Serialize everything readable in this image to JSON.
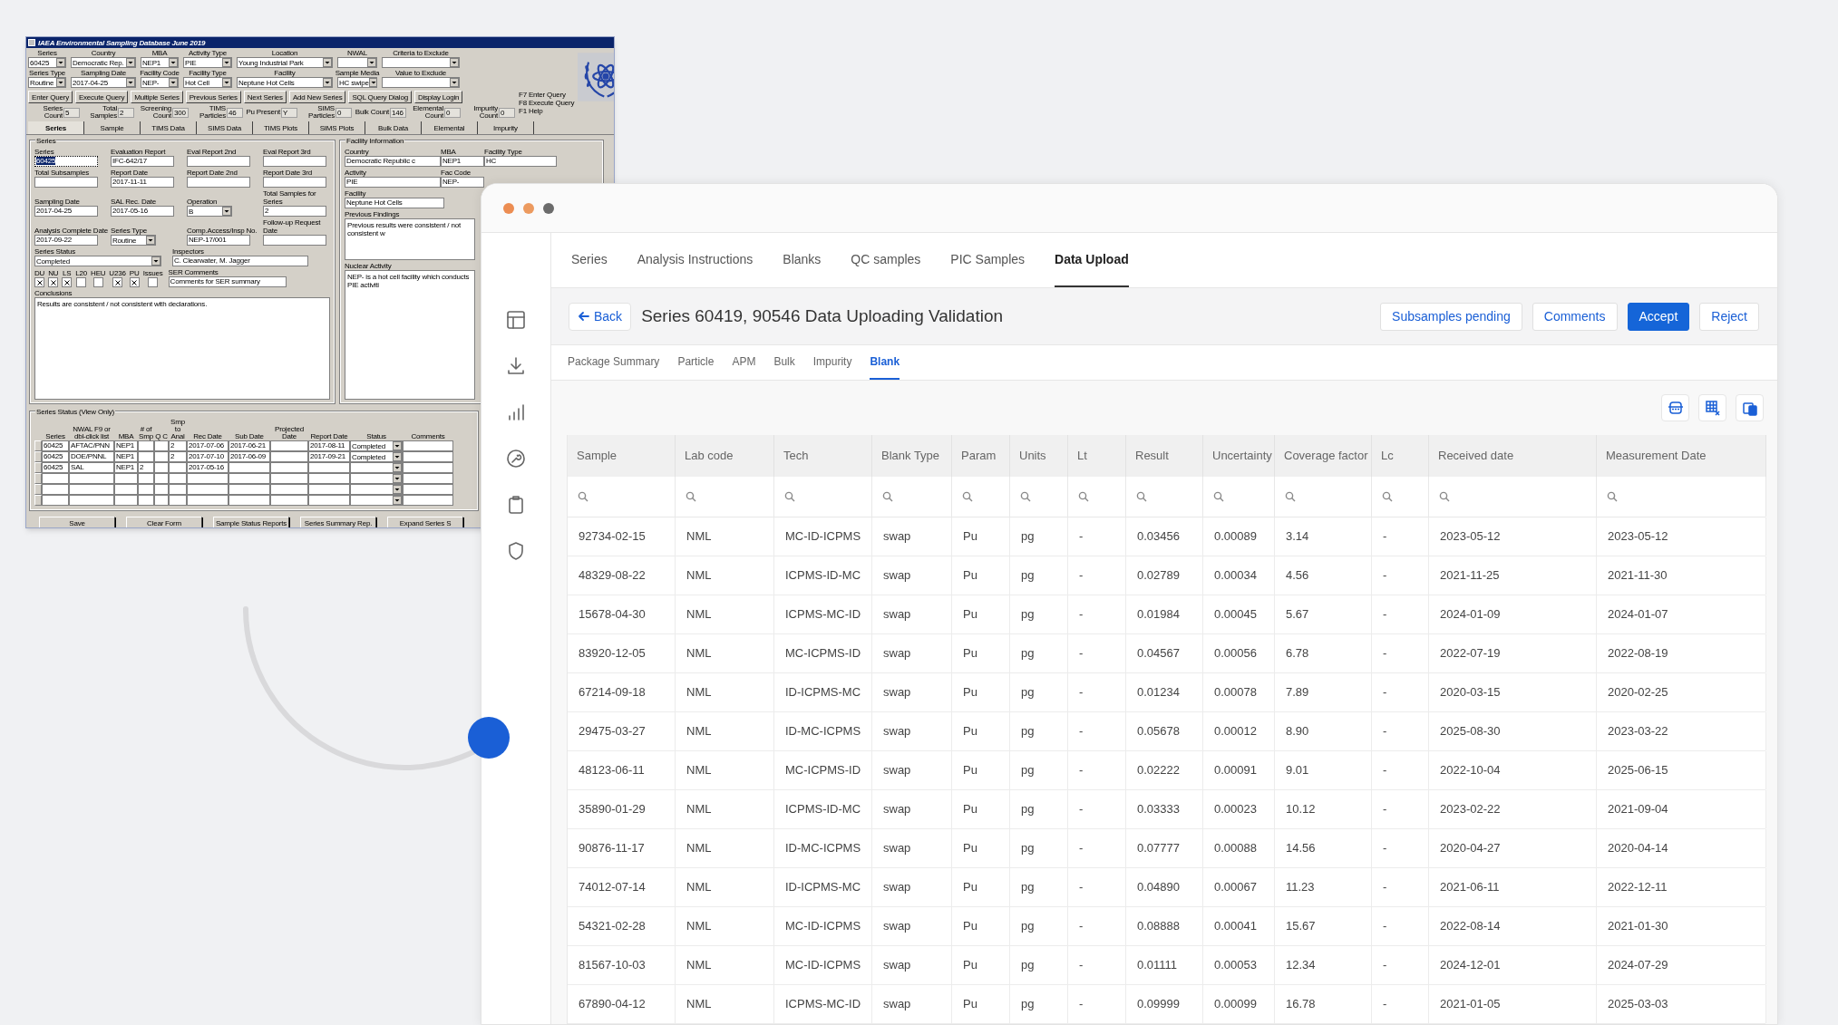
{
  "legacy_window": {
    "title": "IAEA Environmental Sampling Database June 2019",
    "query_rows": [
      [
        {
          "label": "Series",
          "value": "60425"
        },
        {
          "label": "Country",
          "value": "Democratic Rep."
        },
        {
          "label": "MBA",
          "value": "NEP1"
        },
        {
          "label": "Activity Type",
          "value": "PIE"
        },
        {
          "label": "Location",
          "value": "Young Industrial Park"
        },
        {
          "label": "NWAL"
        },
        {
          "label": "Criteria to Exclude"
        }
      ],
      [
        {
          "label": "Series Type",
          "value": "Routine"
        },
        {
          "label": "Sampling Date",
          "value": "2017-04-25"
        },
        {
          "label": "Facility Code",
          "value": "NEP-"
        },
        {
          "label": "Facility Type",
          "value": "Hot Cell"
        },
        {
          "label": "Facility",
          "value": "Neptune Hot Cells"
        },
        {
          "label": "Sample Media",
          "value": "HC swipe"
        },
        {
          "label": "Value to Exclude"
        }
      ]
    ],
    "buttons": [
      "Enter Query",
      "Execute Query",
      "Multiple Series",
      "Previous Series",
      "Next Series",
      "Add New Series",
      "SQL Query Dialog",
      "Display Login"
    ],
    "hotkeys": [
      "F7 Enter Query",
      "F8 Execute Query",
      "F1 Help"
    ],
    "counts": [
      {
        "label": "Series Count",
        "value": "5"
      },
      {
        "label": "Total Samples",
        "value": "2"
      },
      {
        "label": "Screening Count",
        "value": "300"
      },
      {
        "label": "TIMS Particles",
        "value": "46"
      },
      {
        "label": "Pu Present",
        "value": "Y"
      },
      {
        "label": "SIMS Particles",
        "value": "0"
      },
      {
        "label": "Bulk Count",
        "value": "146"
      },
      {
        "label": "Elemental Count",
        "value": "0"
      },
      {
        "label": "Impurity Count",
        "value": "0"
      }
    ],
    "tabs": [
      {
        "label": "Series",
        "selected": true
      },
      {
        "label": "Sample",
        "selected": false
      },
      {
        "label": "TIMS Data",
        "selected": false
      },
      {
        "label": "SIMS Data",
        "selected": false
      },
      {
        "label": "TIMS Plots",
        "selected": false
      },
      {
        "label": "SIMS Plots",
        "selected": false
      },
      {
        "label": "Bulk Data",
        "selected": false
      },
      {
        "label": "Elemental",
        "selected": false
      },
      {
        "label": "Impurity",
        "selected": false
      }
    ],
    "series_group": {
      "title": "Series",
      "rows": [
        [
          {
            "label": "Series",
            "value": "60425",
            "kind": "text",
            "selected": true
          },
          {
            "label": "Evaluation Report",
            "value": "IFC-642/17",
            "kind": "text",
            "selected": false
          },
          {
            "label": "Eval Report 2nd",
            "kind": "text",
            "selected": false
          },
          {
            "label": "Eval Report 3rd",
            "kind": "text",
            "selected": false
          }
        ],
        [
          {
            "label": "Total Subsamples",
            "kind": "text",
            "selected": false
          },
          {
            "label": "Report Date",
            "value": "2017-11-11",
            "kind": "text",
            "selected": false
          },
          {
            "label": "Report Date 2nd",
            "kind": "text",
            "selected": false
          },
          {
            "label": "Report Date 3rd",
            "kind": "text",
            "selected": false
          }
        ],
        [
          {
            "label": "Sampling Date",
            "value": "2017-04-25",
            "kind": "text",
            "selected": false
          },
          {
            "label": "SAL Rec. Date",
            "value": "2017-05-16",
            "kind": "text",
            "selected": false
          },
          {
            "label": "Operation",
            "value": "B",
            "kind": "combo",
            "selected": false
          },
          {
            "label": "Total Samples for Series",
            "value": "2",
            "kind": "text",
            "selected": false
          }
        ],
        [
          {
            "label": "Analysis Complete Date",
            "value": "2017-09-22",
            "kind": "text",
            "selected": false
          },
          {
            "label": "Series Type",
            "value": "Routine",
            "kind": "combo",
            "selected": false
          },
          {
            "label": "Comp.Access/Insp No.",
            "value": "NEP-17/001",
            "kind": "text",
            "selected": false
          },
          {
            "label": "Follow-up Request Date",
            "kind": "text",
            "selected": false
          }
        ]
      ],
      "series_status": {
        "label": "Series Status",
        "value": "Completed"
      },
      "inspectors": {
        "label": "Inspectors",
        "value": "C. Clearwater, M. Jagger"
      },
      "flags": [
        {
          "label": "DU",
          "checked": true
        },
        {
          "label": "NU",
          "checked": true
        },
        {
          "label": "LS",
          "checked": true
        },
        {
          "label": "L20",
          "checked": false
        },
        {
          "label": "HEU",
          "checked": false
        },
        {
          "label": "U236",
          "checked": true
        },
        {
          "label": "PU",
          "checked": true
        },
        {
          "label": "Issues",
          "checked": false
        }
      ],
      "ser_comments": {
        "label": "SER Comments",
        "value": "Comments for SER summary"
      },
      "conclusions": {
        "label": "Conclusions",
        "value": "Results are consistent / not consistent with declarations."
      }
    },
    "facility_group": {
      "title": "Facility Information",
      "rows": [
        [
          {
            "label": "Country",
            "value": "Democratic Republic c",
            "kind": "text"
          },
          {
            "label": "MBA",
            "value": "NEP1",
            "kind": "text"
          },
          {
            "label": "Facility Type",
            "value": "HC",
            "kind": "text"
          }
        ],
        [
          {
            "label": "Activity",
            "value": "PIE",
            "kind": "text"
          },
          {
            "label": "Fac Code",
            "value": "NEP-",
            "kind": "text"
          }
        ],
        [
          {
            "label": "Facility",
            "value": "Neptune Hot Cells",
            "kind": "text_wide"
          }
        ]
      ],
      "previous_findings": {
        "label": "Previous Findings",
        "value": "Previous results were consistent / not consistent w"
      },
      "nuclear_activity": {
        "label": "Nuclear Activity",
        "value": "NEP- is a hot cell facility which conducts PIE activiti"
      }
    },
    "status_table": {
      "title": "Series Status (View Only)",
      "columns": [
        "Series",
        "NWAL F9 or dbl-click list",
        "MBA",
        "# of Smp",
        "Q C",
        "Smp to Anal",
        "Rec Date",
        "Sub Date",
        "Projected Date",
        "Report Date",
        "Status",
        "Comments"
      ],
      "rows": [
        {
          "series": "60425",
          "nwal": "AFTAC/PNN",
          "mba": "NEP1",
          "smp_to_anal": "2",
          "rec_date": "2017-07-06",
          "sub_date": "2017-06-21",
          "report_date": "2017-08-11",
          "status": "Completed"
        },
        {
          "series": "60425",
          "nwal": "DOE/PNNL",
          "mba": "NEP1",
          "smp_to_anal": "2",
          "rec_date": "2017-07-10",
          "sub_date": "2017-06-09",
          "report_date": "2017-09-21",
          "status": "Completed"
        },
        {
          "series": "60425",
          "nwal": "SAL",
          "mba": "NEP1",
          "smp_count": "2",
          "rec_date": "2017-05-16"
        }
      ]
    },
    "bottom_buttons": [
      "Save",
      "Clear Form",
      "Sample Status Reports",
      "Series Summary Rep.",
      "Expand Series S"
    ]
  },
  "app": {
    "nav_tabs": [
      {
        "label": "Series",
        "selected": false
      },
      {
        "label": "Analysis Instructions",
        "selected": false
      },
      {
        "label": "Blanks",
        "selected": false
      },
      {
        "label": "QC samples",
        "selected": false
      },
      {
        "label": "PIC Samples",
        "selected": false
      },
      {
        "label": "Data Upload",
        "selected": true
      }
    ],
    "back_button": "Back",
    "page_title": "Series 60419, 90546 Data Uploading Validation",
    "actions": [
      {
        "label": "Subsamples pending",
        "kind": "outline"
      },
      {
        "label": "Comments",
        "kind": "outline"
      },
      {
        "label": "Accept",
        "kind": "primary"
      },
      {
        "label": "Reject",
        "kind": "outline"
      }
    ],
    "sub_tabs": [
      {
        "label": "Package Summary",
        "selected": false
      },
      {
        "label": "Particle",
        "selected": false
      },
      {
        "label": "APM",
        "selected": false
      },
      {
        "label": "Bulk",
        "selected": false
      },
      {
        "label": "Impurity",
        "selected": false
      },
      {
        "label": "Blank",
        "selected": true
      }
    ],
    "table": {
      "columns": [
        "Sample",
        "Lab code",
        "Tech",
        "Blank Type",
        "Param",
        "Units",
        "Lt",
        "Result",
        "Uncertainty",
        "Coverage factor",
        "Lc",
        "Received date",
        "Measurement Date"
      ],
      "rows": [
        [
          "92734-02-15",
          "NML",
          "MC-ID-ICPMS",
          "swap",
          "Pu",
          "pg",
          "-",
          "0.03456",
          "0.00089",
          "3.14",
          "-",
          "2023-05-12",
          "2023-05-12"
        ],
        [
          "48329-08-22",
          "NML",
          "ICPMS-ID-MC",
          "swap",
          "Pu",
          "pg",
          "-",
          "0.02789",
          "0.00034",
          "4.56",
          "-",
          "2021-11-25",
          "2021-11-30"
        ],
        [
          "15678-04-30",
          "NML",
          "ICPMS-MC-ID",
          "swap",
          "Pu",
          "pg",
          "-",
          "0.01984",
          "0.00045",
          "5.67",
          "-",
          "2024-01-09",
          "2024-01-07"
        ],
        [
          "83920-12-05",
          "NML",
          "MC-ICPMS-ID",
          "swap",
          "Pu",
          "pg",
          "-",
          "0.04567",
          "0.00056",
          "6.78",
          "-",
          "2022-07-19",
          "2022-08-19"
        ],
        [
          "67214-09-18",
          "NML",
          "ID-ICPMS-MC",
          "swap",
          "Pu",
          "pg",
          "-",
          "0.01234",
          "0.00078",
          "7.89",
          "-",
          "2020-03-15",
          "2020-02-25"
        ],
        [
          "29475-03-27",
          "NML",
          "ID-MC-ICPMS",
          "swap",
          "Pu",
          "pg",
          "-",
          "0.05678",
          "0.00012",
          "8.90",
          "-",
          "2025-08-30",
          "2023-03-22"
        ],
        [
          "48123-06-11",
          "NML",
          "MC-ICPMS-ID",
          "swap",
          "Pu",
          "pg",
          "-",
          "0.02222",
          "0.00091",
          "9.01",
          "-",
          "2022-10-04",
          "2025-06-15"
        ],
        [
          "35890-01-29",
          "NML",
          "ICPMS-ID-MC",
          "swap",
          "Pu",
          "pg",
          "-",
          "0.03333",
          "0.00023",
          "10.12",
          "-",
          "2023-02-22",
          "2021-09-04"
        ],
        [
          "90876-11-17",
          "NML",
          "ID-MC-ICPMS",
          "swap",
          "Pu",
          "pg",
          "-",
          "0.07777",
          "0.00088",
          "14.56",
          "-",
          "2020-04-27",
          "2020-04-14"
        ],
        [
          "74012-07-14",
          "NML",
          "ID-ICPMS-MC",
          "swap",
          "Pu",
          "pg",
          "-",
          "0.04890",
          "0.00067",
          "11.23",
          "-",
          "2021-06-11",
          "2022-12-11"
        ],
        [
          "54321-02-28",
          "NML",
          "MC-ID-ICPMS",
          "swap",
          "Pu",
          "pg",
          "-",
          "0.08888",
          "0.00041",
          "15.67",
          "-",
          "2022-08-14",
          "2021-01-30"
        ],
        [
          "81567-10-03",
          "NML",
          "MC-ID-ICPMS",
          "swap",
          "Pu",
          "pg",
          "-",
          "0.01111",
          "0.00053",
          "12.34",
          "-",
          "2024-12-01",
          "2024-07-29"
        ],
        [
          "67890-04-12",
          "NML",
          "ICPMS-MC-ID",
          "swap",
          "Pu",
          "pg",
          "-",
          "0.09999",
          "0.00099",
          "16.78",
          "-",
          "2021-01-05",
          "2025-03-03"
        ]
      ]
    }
  }
}
